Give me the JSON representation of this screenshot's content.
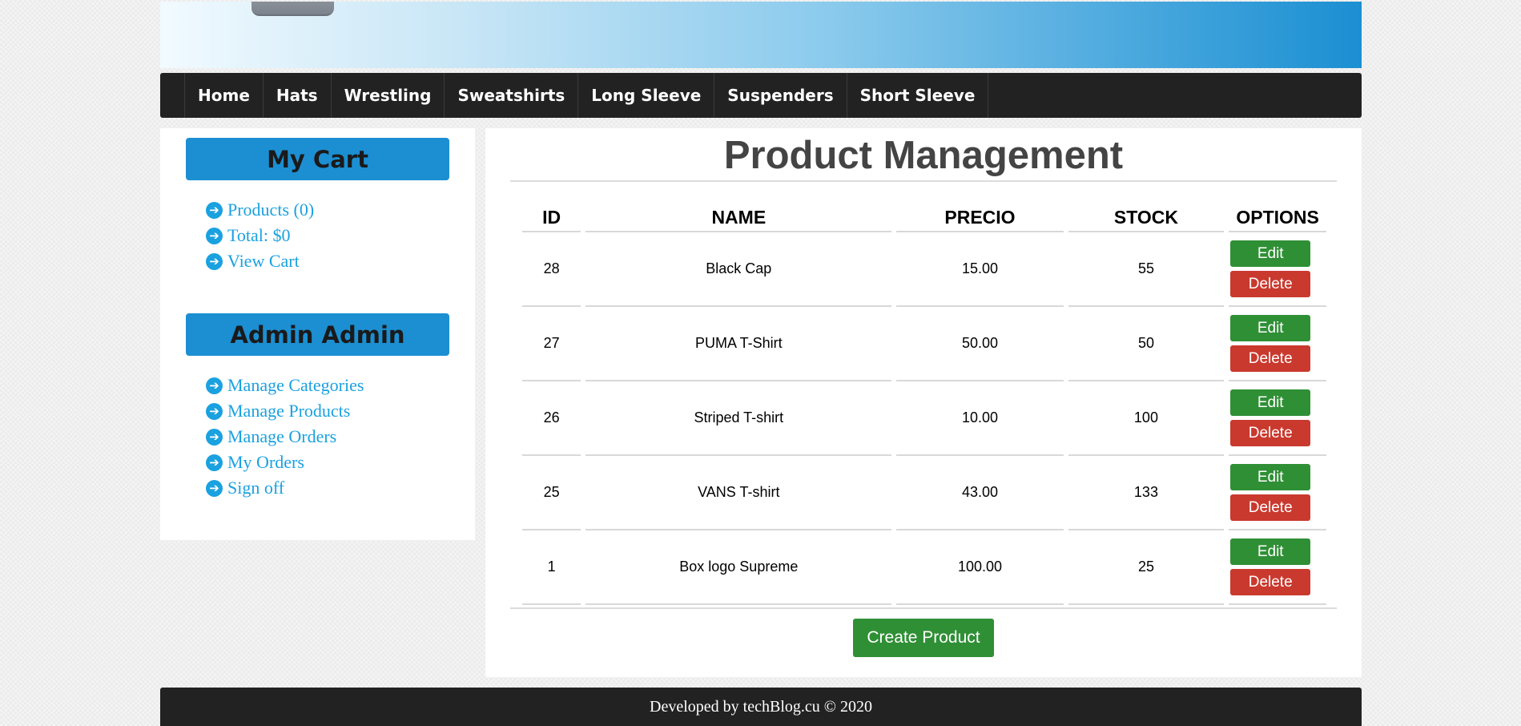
{
  "nav": {
    "items": [
      "Home",
      "Hats",
      "Wrestling",
      "Sweatshirts",
      "Long Sleeve",
      "Suspenders",
      "Short Sleeve"
    ]
  },
  "cart": {
    "heading": "My Cart",
    "links": [
      "Products (0)",
      "Total: $0",
      "View Cart"
    ]
  },
  "admin": {
    "heading": "Admin Admin",
    "links": [
      "Manage Categories",
      "Manage Products",
      "Manage Orders",
      "My Orders",
      "Sign off"
    ]
  },
  "main": {
    "title": "Product Management",
    "columns": [
      "ID",
      "NAME",
      "PRECIO",
      "STOCK",
      "OPTIONS"
    ],
    "rows": [
      {
        "id": "28",
        "name": "Black Cap",
        "precio": "15.00",
        "stock": "55"
      },
      {
        "id": "27",
        "name": "PUMA T-Shirt",
        "precio": "50.00",
        "stock": "50"
      },
      {
        "id": "26",
        "name": "Striped T-shirt",
        "precio": "10.00",
        "stock": "100"
      },
      {
        "id": "25",
        "name": "VANS T-shirt",
        "precio": "43.00",
        "stock": "133"
      },
      {
        "id": "1",
        "name": "Box logo Supreme",
        "precio": "100.00",
        "stock": "25"
      }
    ],
    "edit_label": "Edit",
    "delete_label": "Delete",
    "create_label": "Create Product"
  },
  "footer": {
    "text": "Developed by techBlog.cu © 2020"
  },
  "colors": {
    "accent": "#1b8fd2",
    "link": "#1aa1e0",
    "nav_bg": "#222222",
    "edit": "#2f8f35",
    "delete": "#c9392e"
  },
  "icons": {
    "link_bullet": "circle-arrow-right-icon"
  }
}
